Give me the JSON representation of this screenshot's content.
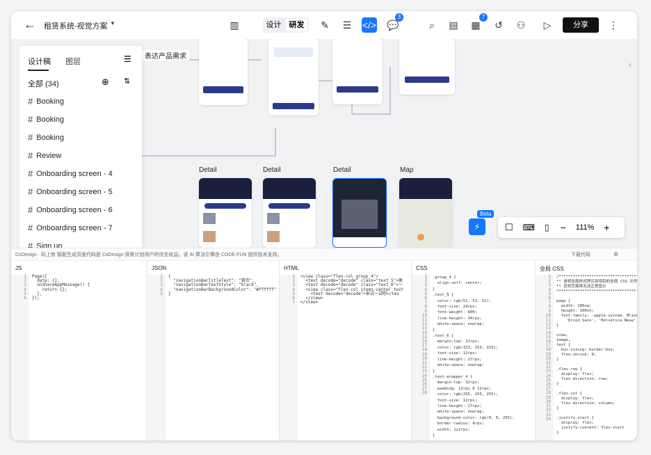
{
  "topbar": {
    "back": "←",
    "title": "租赁系统-视觉方案",
    "seg_design": "设计",
    "seg_dev": "研发",
    "comment_count": "3",
    "history_count": "7",
    "share": "分享"
  },
  "canvas": {
    "note": "表达产品需求",
    "frames": [
      {
        "label": "Detail"
      },
      {
        "label": "Detail"
      },
      {
        "label": "Detail"
      },
      {
        "label": "Map"
      }
    ]
  },
  "panel": {
    "tab1": "设计稿",
    "tab2": "图层",
    "header": "全部 (34)",
    "items": [
      "Booking",
      "Booking",
      "Booking",
      "Review",
      "Onboarding screen - 4",
      "Onboarding screen - 5",
      "Onboarding screen - 6",
      "Onboarding screen - 7",
      "Sign up"
    ]
  },
  "toolbar": {
    "beta": "Beta",
    "zoom": "111%"
  },
  "bottom": {
    "notice": "CoDesign · 码上有   智能生成页面代码是 CoDesign 探索计划用户的优先权益。该 AI 算法引擎由  CODE.FUN 提供技术支持。",
    "download": "下载代码",
    "cols": [
      {
        "name": "JS",
        "lines": "1\n2\n3\n4\n5\n6",
        "code": "Page({\n  data: {},\n  onShareAppMessage() {\n    return {};\n  },\n});"
      },
      {
        "name": "JSON",
        "lines": "1\n2\n3\n4\n5",
        "code": "{\n  \"navigationBarTitleText\": \"首页\",\n  \"navigationBarTextStyle\": \"black\",\n  \"navigationBarBackgroundColor\": \"#ffffff\"\n}"
      },
      {
        "name": "HTML",
        "lines": "1\n2\n3\n4\n5\n6\n7",
        "code": "<view class=\"flex-col group_4\">\n  <text decode=\"decode\" class=\"text_5\">更\n  <text decode=\"decode\" class=\"text_6\">一\n  <view class=\"flex-col items-center text\n    <text decode=\"decode\">来试一试吧</tex\n  </view>\n</view>"
      },
      {
        "name": "CSS",
        "lines": "1\n2\n3\n4\n5\n6\n7\n8\n9\n10\n11\n12\n13\n14\n15\n16\n17\n18\n19\n20\n21\n22\n23\n24\n25\n26\n27\n28",
        "code": ".group_4 {\n  align-self: center;\n}\n.text_5 {\n  color: rgb(51, 51, 51);\n  font-size: 24rpx;\n  font-weight: 600;\n  line-height: 34rpx;\n  white-space: nowrap;\n}\n.text_6 {\n  margin-top: 12rpx;\n  color: rgb(153, 153, 153);\n  font-size: 12rpx;\n  line-height: 17rpx;\n  white-space: nowrap;\n}\n.text-wrapper_4 {\n  margin-top: 32rpx;\n  padding: 12rpx 0 12rpx;\n  color: rgb(255, 255, 255);\n  font-size: 12rpx;\n  line-height: 17rpx;\n  white-space: nowrap;\n  background-color: rgb(0, 0, 255);\n  border-radius: 4rpx;\n  width: 122rpx;\n}"
      },
      {
        "name": "全局 CSS",
        "lines": "1\n2\n3\n4\n5\n6\n7\n8\n9\n10\n11\n12\n13\n14\n15\n16\n17\n18\n19\n20\n21\n22\n23\n24\n25\n26\n27\n28\n29\n30\n31\n32\n33\n34",
        "code": "/************************************\n** 请将全局样式拷贝到项目的全局 CSS 文件或\n** 否则页面将无法正常显示\n************************************/\n\npage {\n  width: 100vw;\n  height: 100vh;\n  font-family: -apple-system, BlinkMacSyste\n    'Droid Sans', 'Helvetica Neue', 'Micro\n}\n\nview,\nimage,\ntext {\n  box-sizing: border-box;\n  flex-shrink: 0;\n}\n\n.flex-row {\n  display: flex;\n  flex-direction: row;\n}\n\n.flex-col {\n  display: flex;\n  flex-direction: column;\n}\n\n.justify-start {\n  display: flex;\n  justify-content: flex-start\n}\n"
      }
    ]
  }
}
